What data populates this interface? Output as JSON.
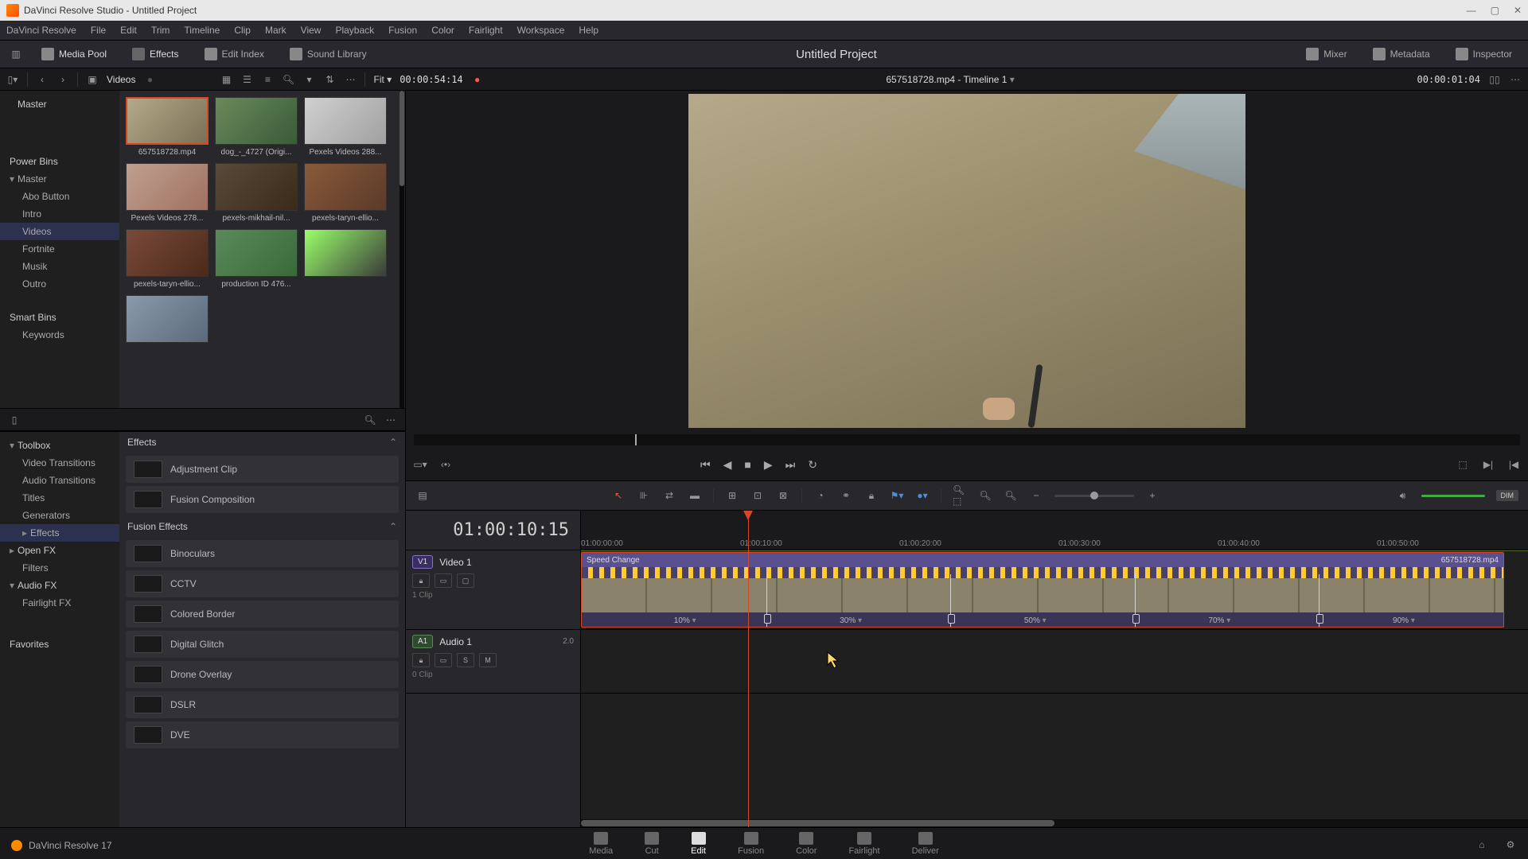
{
  "titlebar": {
    "text": "DaVinci Resolve Studio - Untitled Project"
  },
  "menubar": [
    "DaVinci Resolve",
    "File",
    "Edit",
    "Trim",
    "Timeline",
    "Clip",
    "Mark",
    "View",
    "Playback",
    "Fusion",
    "Color",
    "Fairlight",
    "Workspace",
    "Help"
  ],
  "workspace": {
    "left": [
      {
        "icon": "mediapool",
        "label": "Media Pool"
      },
      {
        "icon": "effects",
        "label": "Effects"
      },
      {
        "icon": "editindex",
        "label": "Edit Index"
      },
      {
        "icon": "soundlib",
        "label": "Sound Library"
      }
    ],
    "title": "Untitled Project",
    "right": [
      {
        "icon": "mixer",
        "label": "Mixer"
      },
      {
        "icon": "metadata",
        "label": "Metadata"
      },
      {
        "icon": "inspector",
        "label": "Inspector"
      }
    ]
  },
  "mediabar": {
    "folder": "Videos",
    "fit": "Fit",
    "viewer_tc": "00:00:54:14",
    "timeline_title": "657518728.mp4 - Timeline 1",
    "viewer_tc_right": "00:00:01:04"
  },
  "bins": {
    "master": "Master",
    "power_heading": "Power Bins",
    "power_items": [
      "Master",
      "Abo Button",
      "Intro",
      "Videos",
      "Fortnite",
      "Musik",
      "Outro"
    ],
    "power_active": "Videos",
    "smart_heading": "Smart Bins",
    "smart_items": [
      "Keywords"
    ]
  },
  "clips": [
    {
      "name": "657518728.mp4",
      "sel": true,
      "bg": "linear-gradient(135deg,#b5a98a,#7a7055)"
    },
    {
      "name": "dog_-_4727 (Origi...",
      "bg": "linear-gradient(135deg,#6a8a5a,#3a5a3a)"
    },
    {
      "name": "Pexels Videos 288...",
      "bg": "linear-gradient(135deg,#d0d0d0,#a0a0a0)"
    },
    {
      "name": "Pexels Videos 278...",
      "bg": "linear-gradient(135deg,#c0a090,#a07060)"
    },
    {
      "name": "pexels-mikhail-nil...",
      "bg": "linear-gradient(135deg,#5a4a3a,#3a2a1a)"
    },
    {
      "name": "pexels-taryn-ellio...",
      "bg": "linear-gradient(135deg,#8a5a3a,#5a3a2a)"
    },
    {
      "name": "pexels-taryn-ellio...",
      "bg": "linear-gradient(135deg,#7a4a3a,#4a2a1a)"
    },
    {
      "name": "production ID 476...",
      "bg": "linear-gradient(135deg,#5a8a5a,#3a6a3a)"
    },
    {
      "name": "",
      "bg": "linear-gradient(135deg,#9aff6a,#3a3a3a)"
    },
    {
      "name": "",
      "bg": "linear-gradient(135deg,#8a9aaa,#5a6a7a)"
    }
  ],
  "fx_tree": {
    "toolbox": "Toolbox",
    "toolbox_items": [
      "Video Transitions",
      "Audio Transitions",
      "Titles",
      "Generators",
      "Effects"
    ],
    "toolbox_active": "Effects",
    "openfx": "Open FX",
    "openfx_items": [
      "Filters"
    ],
    "audiofx": "Audio FX",
    "audiofx_items": [
      "Fairlight FX"
    ],
    "favorites": "Favorites"
  },
  "fx_list": {
    "effects_heading": "Effects",
    "effects": [
      "Adjustment Clip",
      "Fusion Composition"
    ],
    "fusion_heading": "Fusion Effects",
    "fusion": [
      "Binoculars",
      "CCTV",
      "Colored Border",
      "Digital Glitch",
      "Drone Overlay",
      "DSLR",
      "DVE"
    ]
  },
  "transport": {
    "labels": [
      "prev",
      "back",
      "stop",
      "play",
      "next",
      "loop"
    ]
  },
  "timeline": {
    "tc": "01:00:10:15",
    "ruler": [
      "01:00:00:00",
      "01:00:10:00",
      "01:00:20:00",
      "01:00:30:00",
      "01:00:40:00",
      "01:00:50:00"
    ],
    "v1": {
      "tag": "V1",
      "name": "Video 1",
      "info": "1 Clip"
    },
    "a1": {
      "tag": "A1",
      "name": "Audio 1",
      "meter": "2.0",
      "info": "0 Clip",
      "btns": [
        "S",
        "M"
      ]
    },
    "clip": {
      "label": "Speed Change",
      "name": "657518728.mp4"
    },
    "speeds": [
      {
        "pct": "10%",
        "pos": 10
      },
      {
        "pct": "30%",
        "pos": 28
      },
      {
        "pct": "50%",
        "pos": 48
      },
      {
        "pct": "70%",
        "pos": 68
      },
      {
        "pct": "90%",
        "pos": 88
      }
    ],
    "handles": [
      20,
      40,
      60,
      80
    ]
  },
  "dim": "DIM",
  "pages": [
    "Media",
    "Cut",
    "Edit",
    "Fusion",
    "Color",
    "Fairlight",
    "Deliver"
  ],
  "active_page": "Edit",
  "footer": "DaVinci Resolve 17"
}
